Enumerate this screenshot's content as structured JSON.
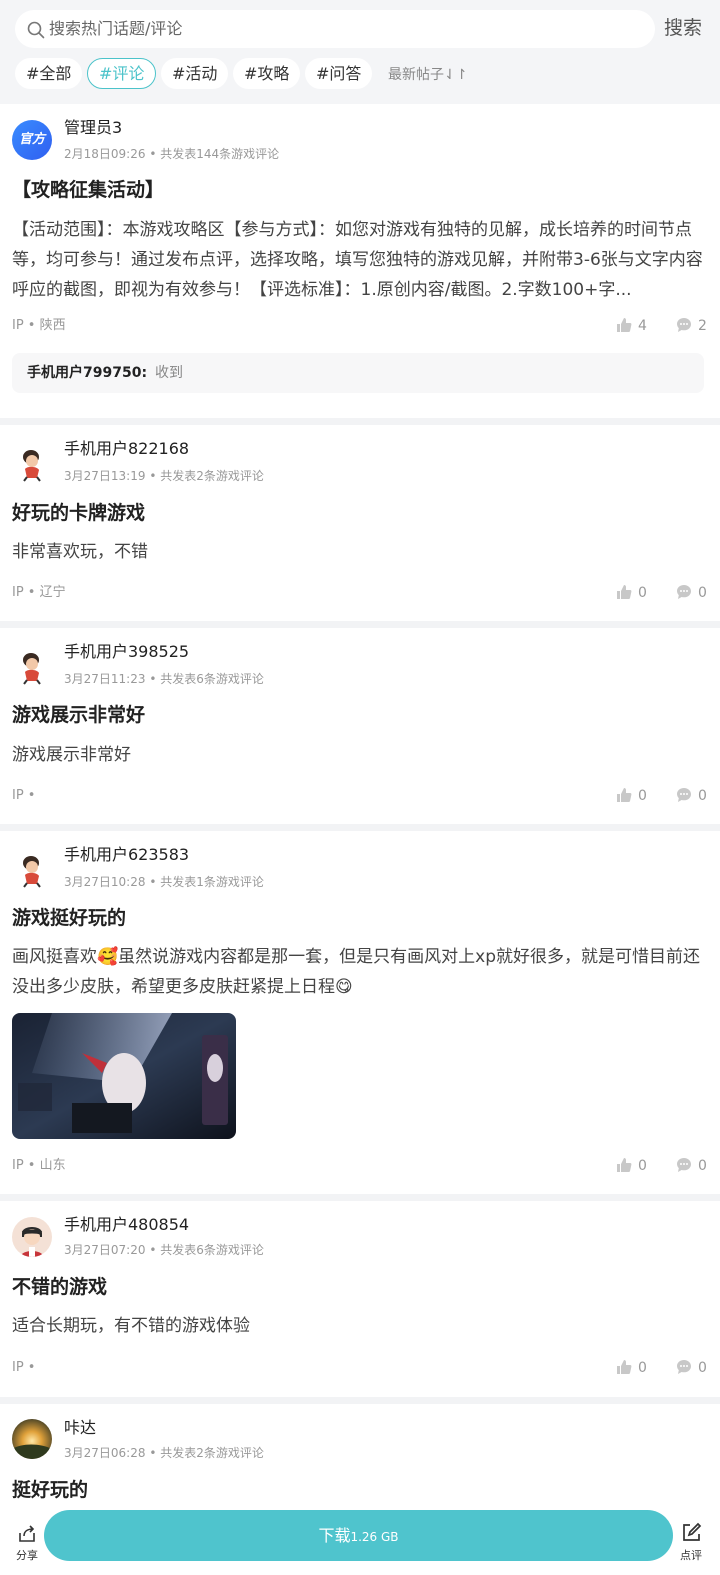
{
  "search": {
    "placeholder": "搜索热门话题/评论",
    "button": "搜索"
  },
  "tags": [
    "#全部",
    "#评论",
    "#活动",
    "#攻略",
    "#问答"
  ],
  "active_tag": "#评论",
  "sort_label": "最新帖子⇃↾",
  "accent_color": "#4fc4cd",
  "posts": [
    {
      "user": "管理员3",
      "avatar_text": "官方",
      "time": "2月18日09:26",
      "stats": "共发表144条游戏评论",
      "title": "【攻略征集活动】",
      "body": "【活动范围】：本游戏攻略区【参与方式】：如您对游戏有独特的见解，成长培养的时间节点等，均可参与！通过发布点评，选择攻略，填写您独特的游戏见解，并附带3-6张与文字内容呼应的截图，即视为有效参与！【评选标准】：1.原创内容/截图。2.字数100+字...",
      "ip": "IP • 陕西",
      "likes": "4",
      "comments": "2",
      "reply_user": "手机用户799750:",
      "reply_text": "收到"
    },
    {
      "user": "手机用户822168",
      "time": "3月27日13:19",
      "stats": "共发表2条游戏评论",
      "title": "好玩的卡牌游戏",
      "body": "非常喜欢玩，不错",
      "ip": "IP • 辽宁",
      "likes": "0",
      "comments": "0"
    },
    {
      "user": "手机用户398525",
      "time": "3月27日11:23",
      "stats": "共发表6条游戏评论",
      "title": "游戏展示非常好",
      "body": "游戏展示非常好",
      "ip": "IP •",
      "likes": "0",
      "comments": "0"
    },
    {
      "user": "手机用户623583",
      "time": "3月27日10:28",
      "stats": "共发表1条游戏评论",
      "title": "游戏挺好玩的",
      "body": "画风挺喜欢🥰虽然说游戏内容都是那一套，但是只有画风对上xp就好很多，就是可惜目前还没出多少皮肤，希望更多皮肤赶紧提上日程😋",
      "ip": "IP • 山东",
      "likes": "0",
      "comments": "0"
    },
    {
      "user": "手机用户480854",
      "time": "3月27日07:20",
      "stats": "共发表6条游戏评论",
      "title": "不错的游戏",
      "body": "适合长期玩，有不错的游戏体验",
      "ip": "IP •",
      "likes": "0",
      "comments": "0"
    },
    {
      "user": "咔达",
      "time": "3月27日06:28",
      "stats": "共发表2条游戏评论",
      "title": "挺好玩的"
    }
  ],
  "bottom": {
    "share": "分享",
    "download": "下载",
    "size": "1.26 GB",
    "rate": "点评"
  }
}
